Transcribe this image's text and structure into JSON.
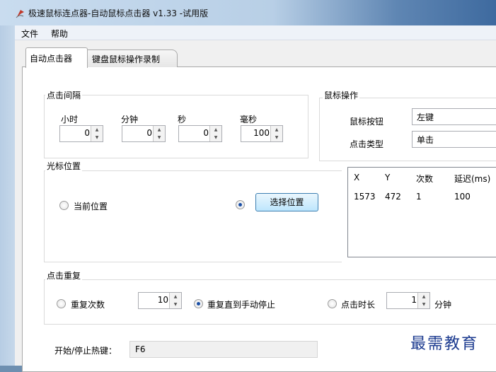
{
  "window": {
    "title": "极速鼠标连点器-自动鼠标点击器 v1.33  -试用版"
  },
  "menu": {
    "items": [
      "文件",
      "帮助"
    ]
  },
  "tabs": [
    {
      "label": "自动点击器",
      "active": true
    },
    {
      "label": "键盘鼠标操作录制",
      "active": false
    }
  ],
  "interval": {
    "title": "点击间隔",
    "hours": {
      "label": "小时",
      "value": "0"
    },
    "minutes": {
      "label": "分钟",
      "value": "0"
    },
    "seconds": {
      "label": "秒",
      "value": "0"
    },
    "milliseconds": {
      "label": "毫秒",
      "value": "100"
    }
  },
  "mouse": {
    "title": "鼠标操作",
    "button_label": "鼠标按钮",
    "button_value": "左键",
    "type_label": "点击类型",
    "type_value": "单击"
  },
  "cursor": {
    "title": "光标位置",
    "current_label": "当前位置",
    "pick_selected": true,
    "pick_button": "选择位置",
    "table": {
      "headers": [
        "X",
        "Y",
        "次数",
        "延迟(ms)"
      ],
      "rows": [
        [
          "1573",
          "472",
          "1",
          "100"
        ]
      ]
    }
  },
  "repeat": {
    "title": "点击重复",
    "count_label": "重复次数",
    "count_value": "10",
    "until_stop_label": "重复直到手动停止",
    "until_stop_selected": true,
    "duration_label": "点击时长",
    "duration_value": "1",
    "duration_unit": "分钟"
  },
  "hotkey": {
    "label": "开始/停止热键：",
    "value": "F6"
  },
  "watermark": "最需教育"
}
